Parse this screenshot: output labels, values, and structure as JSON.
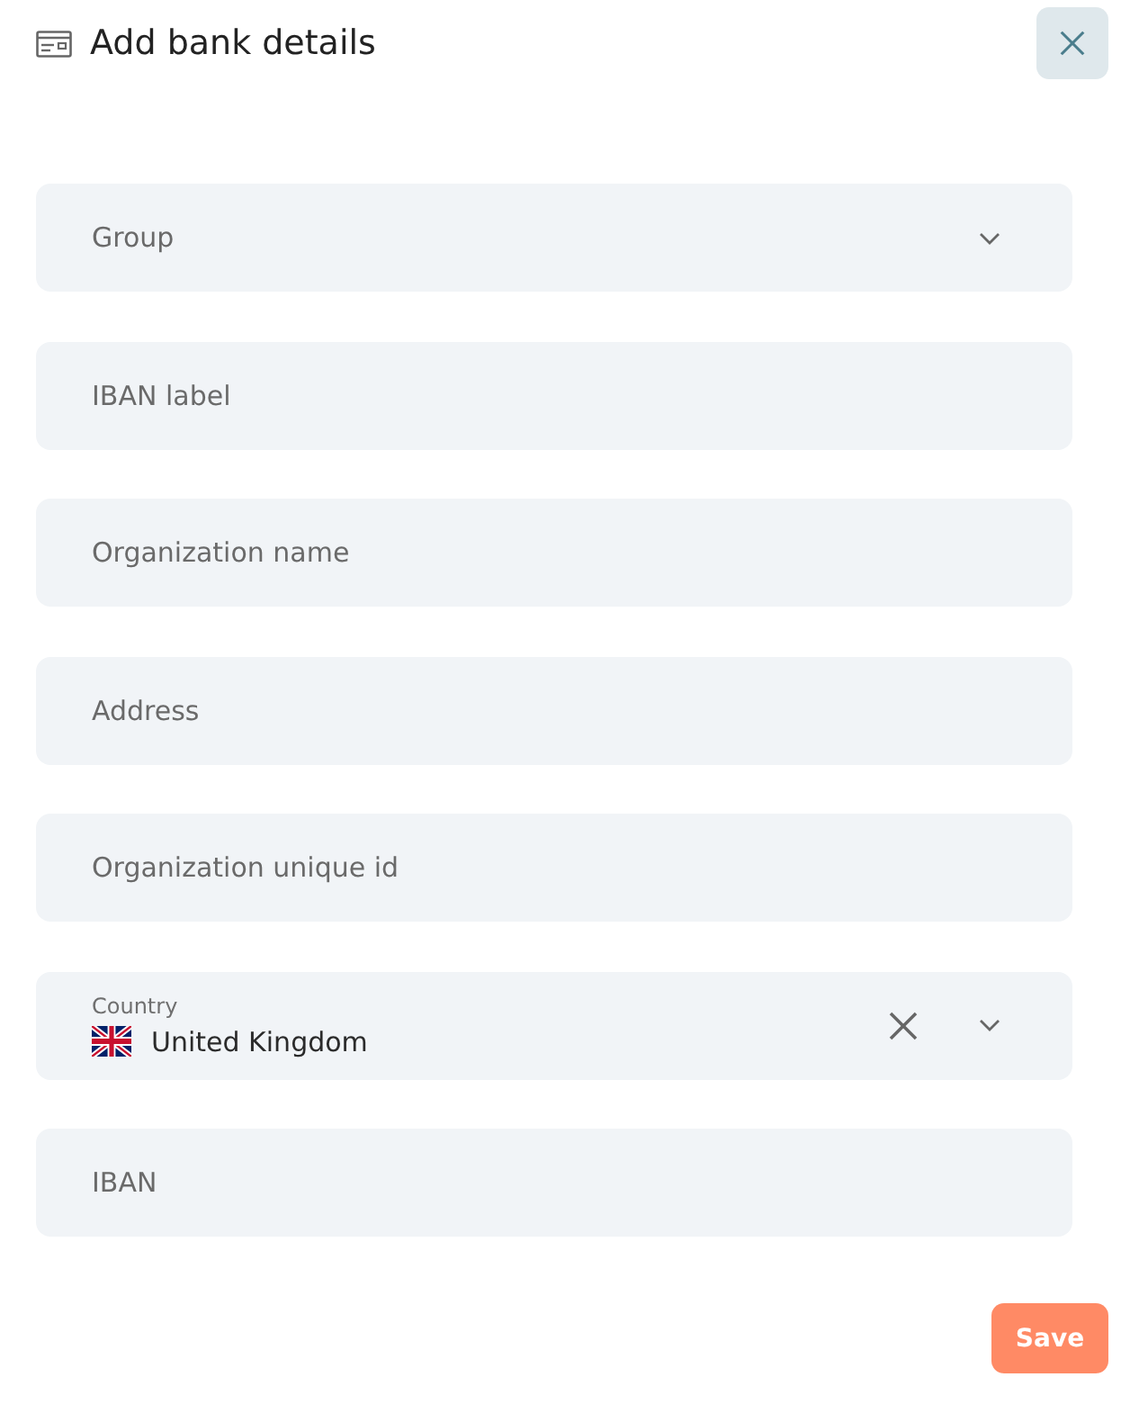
{
  "header": {
    "title": "Add bank details"
  },
  "fields": [
    {
      "kind": "select",
      "placeholder": "Group"
    },
    {
      "kind": "text",
      "placeholder": "IBAN label"
    },
    {
      "kind": "text",
      "placeholder": "Organization name"
    },
    {
      "kind": "text",
      "placeholder": "Address"
    },
    {
      "kind": "text",
      "placeholder": "Organization unique id"
    },
    {
      "kind": "country",
      "label": "Country",
      "value": "United Kingdom"
    },
    {
      "kind": "text",
      "placeholder": "IBAN"
    }
  ],
  "buttons": {
    "save": "Save"
  }
}
